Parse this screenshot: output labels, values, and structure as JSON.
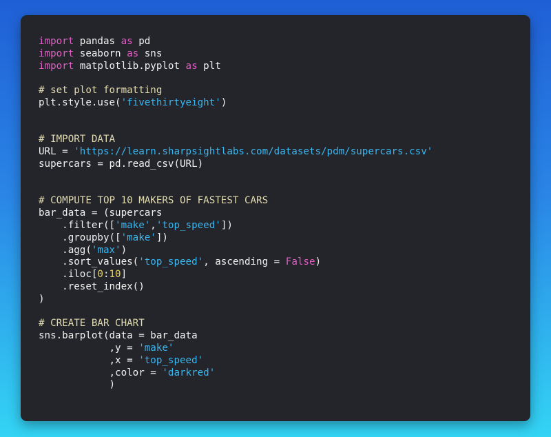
{
  "colors": {
    "keyword": "#e05fc4",
    "string": "#3ab6f0",
    "number": "#e9d25c",
    "comment": "#e3dbb0",
    "text": "#f2f2f2",
    "editor_background": "#23252a"
  },
  "code_lines": [
    [
      {
        "t": "kw",
        "v": "import"
      },
      {
        "t": "txt",
        "v": " pandas "
      },
      {
        "t": "kw",
        "v": "as"
      },
      {
        "t": "txt",
        "v": " pd"
      }
    ],
    [
      {
        "t": "kw",
        "v": "import"
      },
      {
        "t": "txt",
        "v": " seaborn "
      },
      {
        "t": "kw",
        "v": "as"
      },
      {
        "t": "txt",
        "v": " sns"
      }
    ],
    [
      {
        "t": "kw",
        "v": "import"
      },
      {
        "t": "txt",
        "v": " matplotlib.pyplot "
      },
      {
        "t": "kw",
        "v": "as"
      },
      {
        "t": "txt",
        "v": " plt"
      }
    ],
    [],
    [
      {
        "t": "cmt",
        "v": "# set plot formatting"
      }
    ],
    [
      {
        "t": "txt",
        "v": "plt.style.use("
      },
      {
        "t": "str",
        "v": "'fivethirtyeight'"
      },
      {
        "t": "txt",
        "v": ")"
      }
    ],
    [],
    [],
    [
      {
        "t": "cmt",
        "v": "# IMPORT DATA"
      }
    ],
    [
      {
        "t": "txt",
        "v": "URL = "
      },
      {
        "t": "str",
        "v": "'https://learn.sharpsightlabs.com/datasets/pdm/supercars.csv'"
      }
    ],
    [
      {
        "t": "txt",
        "v": "supercars = pd.read_csv(URL)"
      }
    ],
    [],
    [],
    [
      {
        "t": "cmt",
        "v": "# COMPUTE TOP 10 MAKERS OF FASTEST CARS"
      }
    ],
    [
      {
        "t": "txt",
        "v": "bar_data = (supercars"
      }
    ],
    [
      {
        "t": "txt",
        "v": "    .filter(["
      },
      {
        "t": "str",
        "v": "'make'"
      },
      {
        "t": "txt",
        "v": ","
      },
      {
        "t": "str",
        "v": "'top_speed'"
      },
      {
        "t": "txt",
        "v": "])"
      }
    ],
    [
      {
        "t": "txt",
        "v": "    .groupby(["
      },
      {
        "t": "str",
        "v": "'make'"
      },
      {
        "t": "txt",
        "v": "])"
      }
    ],
    [
      {
        "t": "txt",
        "v": "    .agg("
      },
      {
        "t": "str",
        "v": "'max'"
      },
      {
        "t": "txt",
        "v": ")"
      }
    ],
    [
      {
        "t": "txt",
        "v": "    .sort_values("
      },
      {
        "t": "str",
        "v": "'top_speed'"
      },
      {
        "t": "txt",
        "v": ", ascending = "
      },
      {
        "t": "kw",
        "v": "False"
      },
      {
        "t": "txt",
        "v": ")"
      }
    ],
    [
      {
        "t": "txt",
        "v": "    .iloc["
      },
      {
        "t": "num",
        "v": "0"
      },
      {
        "t": "txt",
        "v": ":"
      },
      {
        "t": "num",
        "v": "10"
      },
      {
        "t": "txt",
        "v": "]"
      }
    ],
    [
      {
        "t": "txt",
        "v": "    .reset_index()"
      }
    ],
    [
      {
        "t": "txt",
        "v": ")"
      }
    ],
    [],
    [
      {
        "t": "cmt",
        "v": "# CREATE BAR CHART"
      }
    ],
    [
      {
        "t": "txt",
        "v": "sns.barplot(data = bar_data"
      }
    ],
    [
      {
        "t": "txt",
        "v": "            ,y = "
      },
      {
        "t": "str",
        "v": "'make'"
      }
    ],
    [
      {
        "t": "txt",
        "v": "            ,x = "
      },
      {
        "t": "str",
        "v": "'top_speed'"
      }
    ],
    [
      {
        "t": "txt",
        "v": "            ,color = "
      },
      {
        "t": "str",
        "v": "'darkred'"
      }
    ],
    [
      {
        "t": "txt",
        "v": "            )"
      }
    ]
  ]
}
